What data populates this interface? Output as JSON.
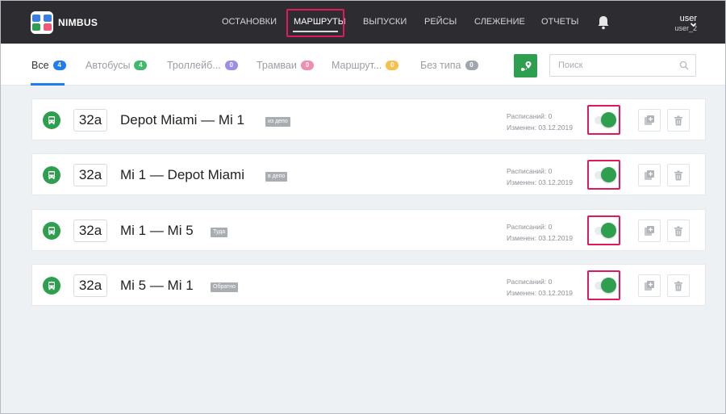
{
  "app": {
    "brand": "NIMBUS"
  },
  "nav": {
    "items": [
      {
        "label": "ОСТАНОВКИ",
        "active": false
      },
      {
        "label": "МАРШРУТЫ",
        "active": true
      },
      {
        "label": "ВЫПУСКИ",
        "active": false
      },
      {
        "label": "РЕЙСЫ",
        "active": false
      },
      {
        "label": "СЛЕЖЕНИЕ",
        "active": false
      },
      {
        "label": "ОТЧЕТЫ",
        "active": false
      }
    ]
  },
  "user": {
    "name": "user",
    "login": "user_2"
  },
  "tabs": [
    {
      "label": "Все",
      "count": "4",
      "color": "#1f7df0",
      "active": true
    },
    {
      "label": "Автобусы",
      "count": "4",
      "color": "#3fba6c",
      "active": false
    },
    {
      "label": "Троллейб...",
      "count": "0",
      "color": "#9a8fe8",
      "active": false
    },
    {
      "label": "Трамваи",
      "count": "0",
      "color": "#f08db0",
      "active": false
    },
    {
      "label": "Маршрут...",
      "count": "0",
      "color": "#f6c04a",
      "active": false
    },
    {
      "label": "Без типа",
      "count": "0",
      "color": "#a0a6ad",
      "active": false
    }
  ],
  "search": {
    "placeholder": "Поиск",
    "value": ""
  },
  "routes": [
    {
      "number": "32a",
      "name": "Depot Miami — Mi 1",
      "tag": "из депо",
      "schedules": "Расписаний: 0",
      "changed": "Изменен: 03.12.2019",
      "enabled": true
    },
    {
      "number": "32a",
      "name": "Mi 1 — Depot Miami",
      "tag": "в депо",
      "schedules": "Расписаний: 0",
      "changed": "Изменен: 03.12.2019",
      "enabled": true
    },
    {
      "number": "32a",
      "name": "Mi 1 — Mi 5",
      "tag": "Туда",
      "schedules": "Расписаний: 0",
      "changed": "Изменен: 03.12.2019",
      "enabled": true
    },
    {
      "number": "32a",
      "name": "Mi 5 — Mi 1",
      "tag": "Обратно",
      "schedules": "Расписаний: 0",
      "changed": "Изменен: 03.12.2019",
      "enabled": true
    }
  ],
  "colors": {
    "accent": "#2e9e4f",
    "highlight": "#e0195a",
    "header_bg": "#2d2d31",
    "active_tab": "#1f7df0"
  },
  "icons": {
    "map": "map-route-icon",
    "search": "search-icon",
    "bell": "bell-icon",
    "bus": "bus-icon",
    "copy": "copy-add-icon",
    "delete": "trash-icon"
  }
}
